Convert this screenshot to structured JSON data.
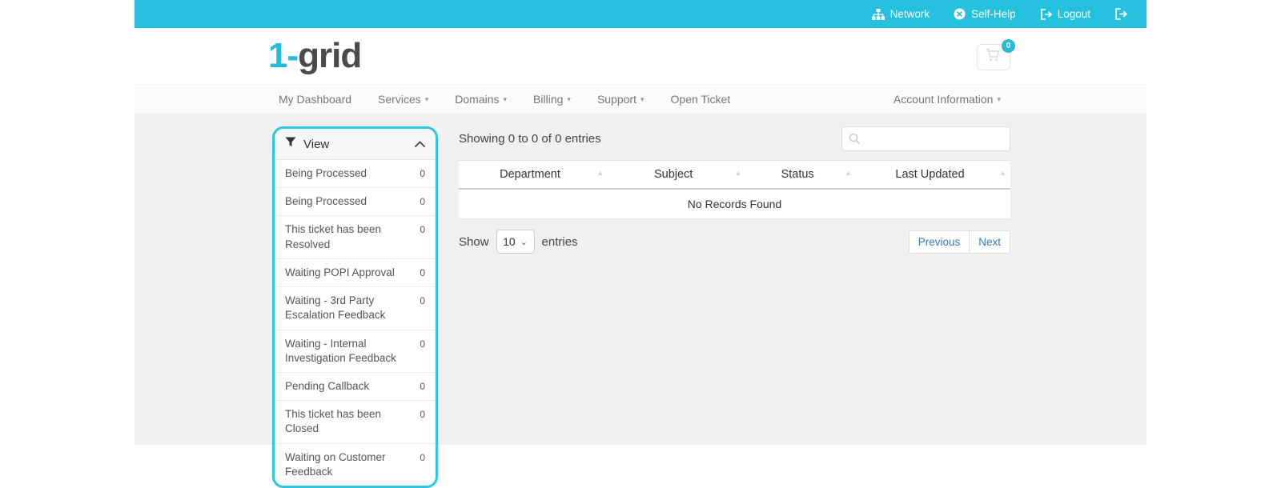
{
  "topbar": {
    "network_label": "Network",
    "selfhelp_label": "Self-Help",
    "logout_label": "Logout"
  },
  "header": {
    "logo_part1": "1-",
    "logo_part2": "grid",
    "cart_count": "0"
  },
  "nav": {
    "items": [
      {
        "label": "My Dashboard",
        "has_dropdown": false
      },
      {
        "label": "Services",
        "has_dropdown": true
      },
      {
        "label": "Domains",
        "has_dropdown": true
      },
      {
        "label": "Billing",
        "has_dropdown": true
      },
      {
        "label": "Support",
        "has_dropdown": true
      },
      {
        "label": "Open Ticket",
        "has_dropdown": false
      }
    ],
    "account_label": "Account Information"
  },
  "sidebar": {
    "title": "View",
    "items": [
      {
        "label": "Being Processed",
        "count": "0"
      },
      {
        "label": "Being Processed",
        "count": "0"
      },
      {
        "label": "This ticket has been Resolved",
        "count": "0"
      },
      {
        "label": "Waiting POPI Approval",
        "count": "0"
      },
      {
        "label": "Waiting - 3rd Party Escalation Feedback",
        "count": "0"
      },
      {
        "label": "Waiting - Internal Investigation Feedback",
        "count": "0"
      },
      {
        "label": "Pending Callback",
        "count": "0"
      },
      {
        "label": "This ticket has been Closed",
        "count": "0"
      },
      {
        "label": "Waiting on Customer Feedback",
        "count": "0"
      }
    ]
  },
  "main": {
    "showing_text": "Showing 0 to 0 of 0 entries",
    "search": {
      "value": "",
      "placeholder": ""
    },
    "table": {
      "columns": [
        "Department",
        "Subject",
        "Status",
        "Last Updated"
      ],
      "empty_text": "No Records Found"
    },
    "page_length": {
      "show_label": "Show",
      "selected": "10",
      "entries_label": "entries"
    },
    "pagination": {
      "previous": "Previous",
      "next": "Next"
    }
  },
  "icons": {
    "caret_down": "▾",
    "sort_asc": "▲",
    "select_chevron": "⌄"
  },
  "colors": {
    "topbar_cyan": "#25c1de",
    "accent_cyan": "#29b9d9",
    "panel_border_cyan": "#2ec5e2",
    "link_blue": "#337ab7",
    "main_bg": "#f0f0f0"
  }
}
